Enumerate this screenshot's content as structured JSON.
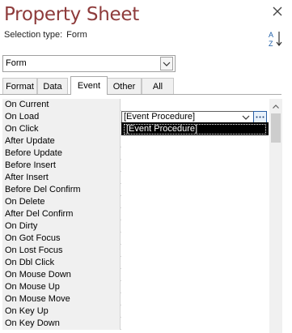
{
  "title": "Property Sheet",
  "selection_type": {
    "label": "Selection type:",
    "value": "Form"
  },
  "object_combo": {
    "value": "Form"
  },
  "tabs": [
    {
      "label": "Format"
    },
    {
      "label": "Data"
    },
    {
      "label": "Event",
      "active": true
    },
    {
      "label": "Other"
    },
    {
      "label": "All"
    }
  ],
  "properties": [
    {
      "name": "On Current",
      "value": ""
    },
    {
      "name": "On Load",
      "value": "[Event Procedure]"
    },
    {
      "name": "On Click",
      "value": ""
    },
    {
      "name": "After Update",
      "value": ""
    },
    {
      "name": "Before Update",
      "value": ""
    },
    {
      "name": "Before Insert",
      "value": ""
    },
    {
      "name": "After Insert",
      "value": ""
    },
    {
      "name": "Before Del Confirm",
      "value": ""
    },
    {
      "name": "On Delete",
      "value": ""
    },
    {
      "name": "After Del Confirm",
      "value": ""
    },
    {
      "name": "On Dirty",
      "value": ""
    },
    {
      "name": "On Got Focus",
      "value": ""
    },
    {
      "name": "On Lost Focus",
      "value": ""
    },
    {
      "name": "On Dbl Click",
      "value": ""
    },
    {
      "name": "On Mouse Down",
      "value": ""
    },
    {
      "name": "On Mouse Up",
      "value": ""
    },
    {
      "name": "On Mouse Move",
      "value": ""
    },
    {
      "name": "On Key Up",
      "value": ""
    },
    {
      "name": "On Key Down",
      "value": ""
    }
  ],
  "dropdown": {
    "options": [
      "[Event Procedure]"
    ],
    "selected": "[Event Procedure]"
  },
  "icons": {
    "close": "close-icon",
    "sort": "sort-az-icon",
    "combo_arrow": "chevron-down-icon",
    "builder": "ellipsis-icon"
  },
  "colors": {
    "title": "#8e3b3b",
    "label_bg": "#f0f0f0",
    "highlight_bg": "#000000"
  }
}
